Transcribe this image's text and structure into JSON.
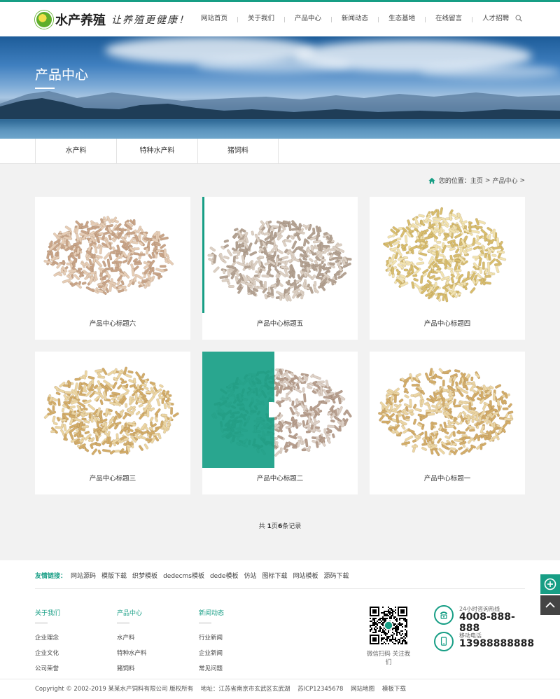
{
  "header": {
    "logo_name": "水产养殖",
    "logo_slogan": "让养殖更健康！",
    "nav": [
      "网站首页",
      "关于我们",
      "产品中心",
      "新闻动态",
      "生态基地",
      "在线留言",
      "人才招聘"
    ]
  },
  "banner": {
    "title": "产品中心"
  },
  "subnav": [
    "水产料",
    "特种水产料",
    "猪饲料"
  ],
  "breadcrumb": {
    "prefix": "您的位置：",
    "home": "主页",
    "sep": ">",
    "current": "产品中心",
    "end": ">"
  },
  "products": [
    {
      "title": "产品中心标题六"
    },
    {
      "title": "产品中心标题五"
    },
    {
      "title": "产品中心标题四"
    },
    {
      "title": "产品中心标题三"
    },
    {
      "title": "产品中心标题二"
    },
    {
      "title": "产品中心标题一"
    }
  ],
  "pager": {
    "pre": "共 ",
    "pages": "1",
    "mid": "页",
    "count": "6",
    "post": "条记录"
  },
  "footer": {
    "links_label": "友情链接：",
    "links": [
      "网站源码",
      "模版下载",
      "织梦模板",
      "dedecms模板",
      "dede模板",
      "仿站",
      "图标下载",
      "网站模板",
      "源码下载"
    ],
    "columns": [
      {
        "title": "关于我们",
        "items": [
          "企业理念",
          "企业文化",
          "公司荣誉"
        ]
      },
      {
        "title": "产品中心",
        "items": [
          "水产料",
          "特种水产料",
          "猪饲料"
        ]
      },
      {
        "title": "新闻动态",
        "items": [
          "行业新闻",
          "企业新闻",
          "常见问题"
        ]
      }
    ],
    "qr_caption": "微信扫码 关注我们",
    "hotline_label": "24小时咨询热线",
    "hotline": "4008-888-888",
    "mobile_label": "移动电话",
    "mobile": "13988888888",
    "copyright": "Copyright © 2002-2019 某某水产饲料有限公司 版权所有",
    "address": "地址：江苏省南京市玄武区玄武湖",
    "icp": "苏ICP12345678",
    "sitemap": "网站地图",
    "template": "模板下载"
  },
  "colors": {
    "accent": "#179e85"
  }
}
